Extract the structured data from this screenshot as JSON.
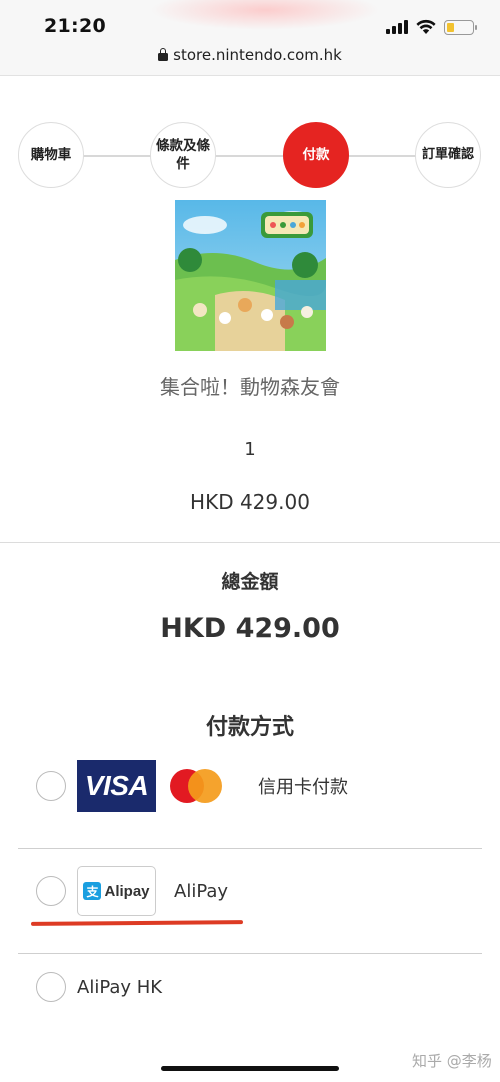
{
  "status_bar": {
    "time": "21:20",
    "battery_level": 0.22,
    "battery_color": "#f2c230"
  },
  "browser": {
    "url": "store.nintendo.com.hk",
    "lock_icon": "lock-icon"
  },
  "stepper": {
    "steps": [
      {
        "label": "購物車",
        "active": false
      },
      {
        "label": "條款及條件",
        "active": false
      },
      {
        "label": "付款",
        "active": true
      },
      {
        "label": "訂單確認",
        "active": false
      }
    ],
    "active_color": "#e52421"
  },
  "product": {
    "title": "集合啦！動物森友會",
    "quantity": "1",
    "price": "HKD 429.00"
  },
  "total": {
    "label": "總金額",
    "value": "HKD 429.00"
  },
  "payment": {
    "title": "付款方式",
    "options": [
      {
        "logos": [
          "VISA",
          "mastercard-icon"
        ],
        "label": "信用卡付款",
        "selected": false
      },
      {
        "logos": [
          "Alipay"
        ],
        "label": "AliPay",
        "selected": false
      },
      {
        "logos": [],
        "label": "AliPay HK",
        "selected": false
      }
    ],
    "visa_text": "VISA",
    "alipay_text": "Alipay",
    "alipay_glyph": "支",
    "annotation_color": "#dd3b24"
  },
  "watermark": "知乎 @李杨"
}
